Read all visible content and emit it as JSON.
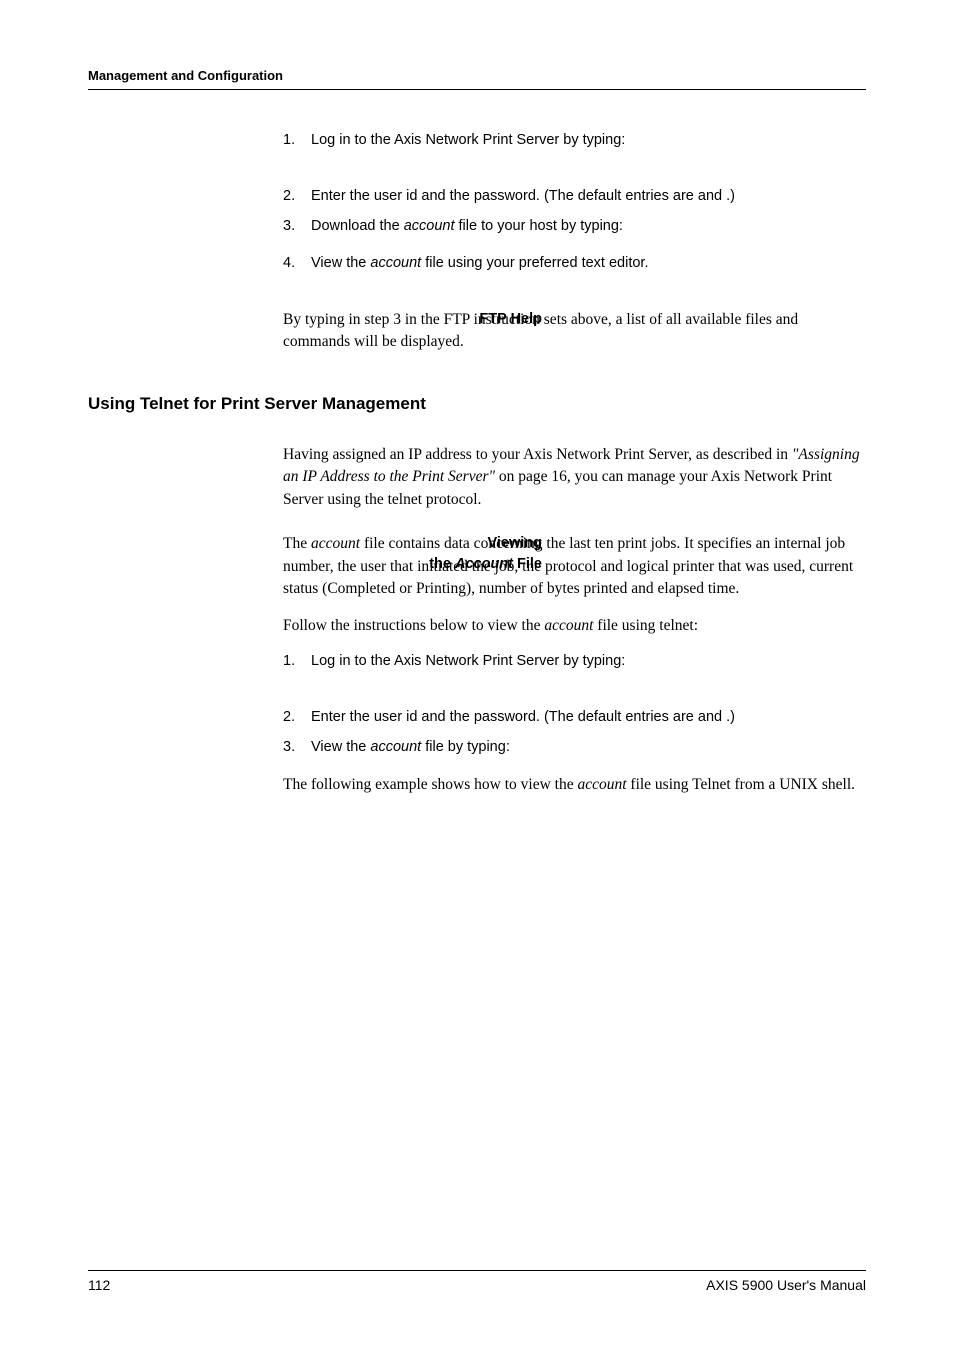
{
  "header": {
    "title": "Management and Configuration"
  },
  "steps_ftp": {
    "items": [
      {
        "num": "1.",
        "text_a": "Log in to the Axis Network Print Server by typing:"
      },
      {
        "num": "2.",
        "text_a": "Enter the user id and the password. (The default entries are ",
        "text_b": " and ",
        "text_c": ".)"
      },
      {
        "num": "3.",
        "text_a": "Download the ",
        "italic_a": "account",
        "text_b": " file to your host by typing:"
      },
      {
        "num": "4.",
        "text_a": "View the ",
        "italic_a": "account",
        "text_b": " file using your preferred text editor."
      }
    ]
  },
  "ftp_help": {
    "label": "FTP Help",
    "text_a": "By typing ",
    "text_b": " in step 3 in the FTP instruction sets above, a list of all available files and commands will be displayed."
  },
  "section": {
    "heading": "Using Telnet for Print Server Management"
  },
  "intro_para": {
    "text_a": "Having assigned an IP address to your Axis Network Print Server, as described in ",
    "italic_a": "\"Assigning an IP Address to the Print Server\"",
    "text_b": " on page 16, you can manage your Axis Network Print Server using the telnet protocol."
  },
  "viewing": {
    "label_line1": "Viewing",
    "label_line2": "the ",
    "label_italic": "Account",
    "label_line2b": " File",
    "para1_a": "The ",
    "para1_italic": "account",
    "para1_b": " file contains data concerning the last ten print jobs. It specifies an internal job number, the user that initiated the job, the protocol and logical printer that was used, current status (Completed or Printing), number of bytes printed and elapsed time.",
    "para2_a": "Follow the instructions below to view the ",
    "para2_italic": "account",
    "para2_b": " file using telnet:"
  },
  "steps_telnet": {
    "items": [
      {
        "num": "1.",
        "text_a": "Log in to the Axis Network Print Server by typing:"
      },
      {
        "num": "2.",
        "text_a": "Enter the user id and the password. (The default entries are ",
        "text_b": " and ",
        "text_c": ".)"
      },
      {
        "num": "3.",
        "text_a": "View the ",
        "italic_a": "account",
        "text_b": " file by typing:"
      }
    ]
  },
  "closing_para": {
    "text_a": "The following example shows how to view the ",
    "italic_a": "account",
    "text_b": " file using Telnet from a UNIX shell."
  },
  "footer": {
    "page": "112",
    "manual": "AXIS 5900 User's Manual"
  }
}
